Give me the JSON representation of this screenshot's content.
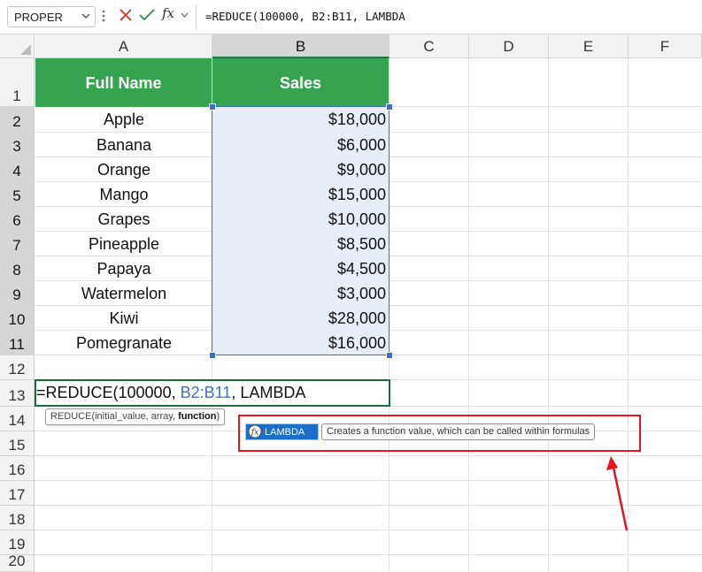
{
  "formula_bar": {
    "name_box": "PROPER",
    "fx_label": "fx",
    "formula": "=REDUCE(100000, B2:B11, LAMBDA"
  },
  "columns": [
    "A",
    "B",
    "C",
    "D",
    "E",
    "F"
  ],
  "rows": [
    "1",
    "2",
    "3",
    "4",
    "5",
    "6",
    "7",
    "8",
    "9",
    "10",
    "11",
    "12",
    "13",
    "14",
    "15",
    "16",
    "17",
    "18",
    "19",
    "20"
  ],
  "table": {
    "headers": [
      "Full Name",
      "Sales"
    ],
    "names": [
      "Apple",
      "Banana",
      "Orange",
      "Mango",
      "Grapes",
      "Pineapple",
      "Papaya",
      "Watermelon",
      "Kiwi",
      "Pomegranate"
    ],
    "sales": [
      "$18,000",
      "$6,000",
      "$9,000",
      "$15,000",
      "$10,000",
      "$8,500",
      "$4,500",
      "$3,000",
      "$28,000",
      "$16,000"
    ]
  },
  "active_cell": {
    "prefix": "=REDUCE(100000, ",
    "ref": "B2:B11",
    "suffix": ", LAMBDA"
  },
  "tooltip": {
    "text": "REDUCE(initial_value, array, ",
    "bold": "function",
    "close": ")"
  },
  "autocomplete": {
    "item": "LAMBDA",
    "description": "Creates a function value, which can be called within formulas"
  },
  "colors": {
    "header_green": "#35a350",
    "selection_blue": "#3b6fc4",
    "highlight_red": "#e6141b",
    "autocomplete_blue": "#1b6fc9"
  }
}
